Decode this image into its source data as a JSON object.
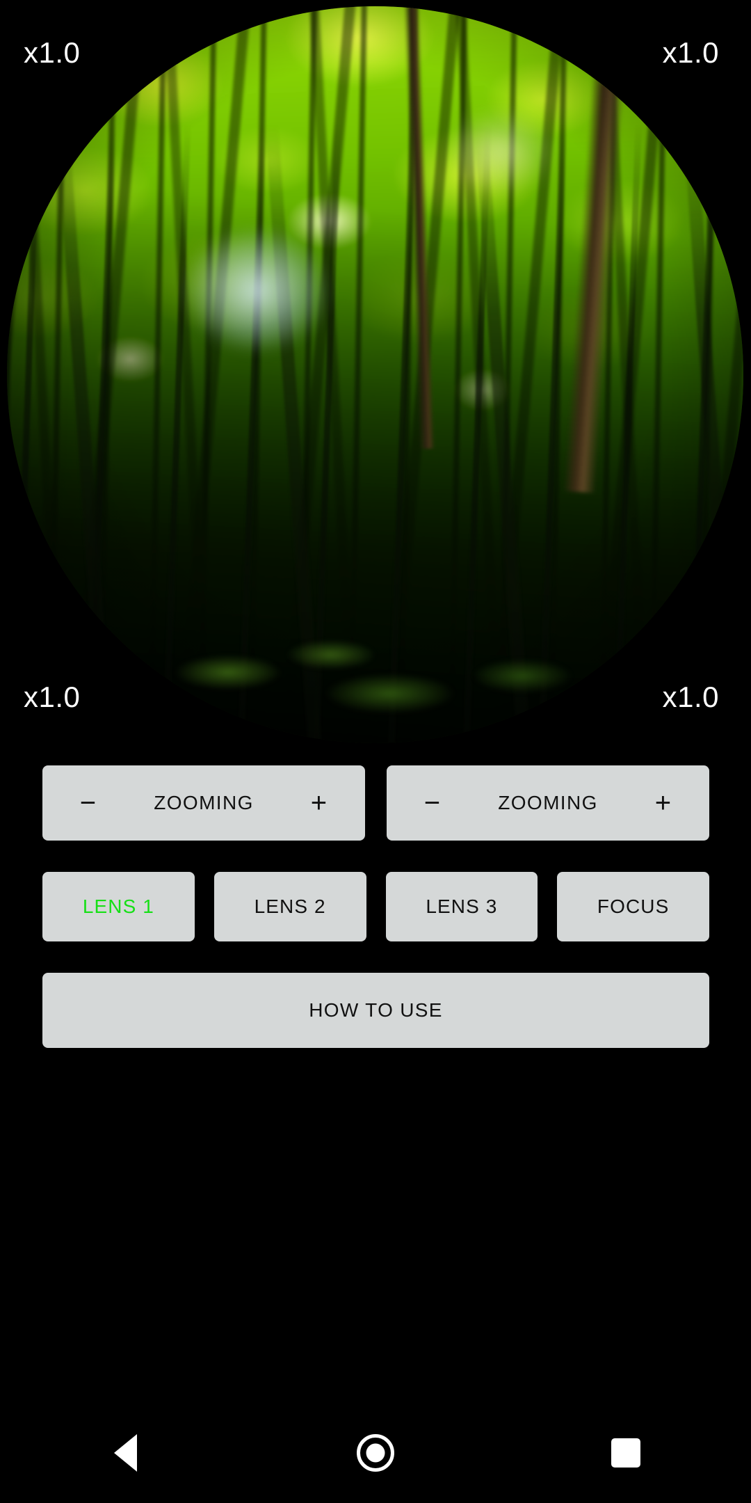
{
  "app": {
    "background_color": "#000000",
    "panel_color": "#d5d8d8",
    "accent_color": "#16e016"
  },
  "viewfinder": {
    "name": "circular-scope-preview",
    "scene": "forest canopy viewed from below through a round telescope/monocular eyepiece",
    "zoom_labels": {
      "top_left": "x1.0",
      "top_right": "x1.0",
      "bottom_left": "x1.0",
      "bottom_right": "x1.0"
    }
  },
  "controls": {
    "zoom_row": [
      {
        "name": "zoom-control-left",
        "minus": "−",
        "label": "ZOOMING",
        "plus": "+"
      },
      {
        "name": "zoom-control-right",
        "minus": "−",
        "label": "ZOOMING",
        "plus": "+"
      }
    ],
    "lens_row": [
      {
        "label": "LENS 1",
        "active": true
      },
      {
        "label": "LENS 2",
        "active": false
      },
      {
        "label": "LENS 3",
        "active": false
      },
      {
        "label": "FOCUS",
        "active": false
      }
    ],
    "help_button": {
      "label": "HOW TO USE"
    }
  },
  "navbar": {
    "back": "back-triangle",
    "home": "home-circle",
    "recents": "recents-square"
  }
}
